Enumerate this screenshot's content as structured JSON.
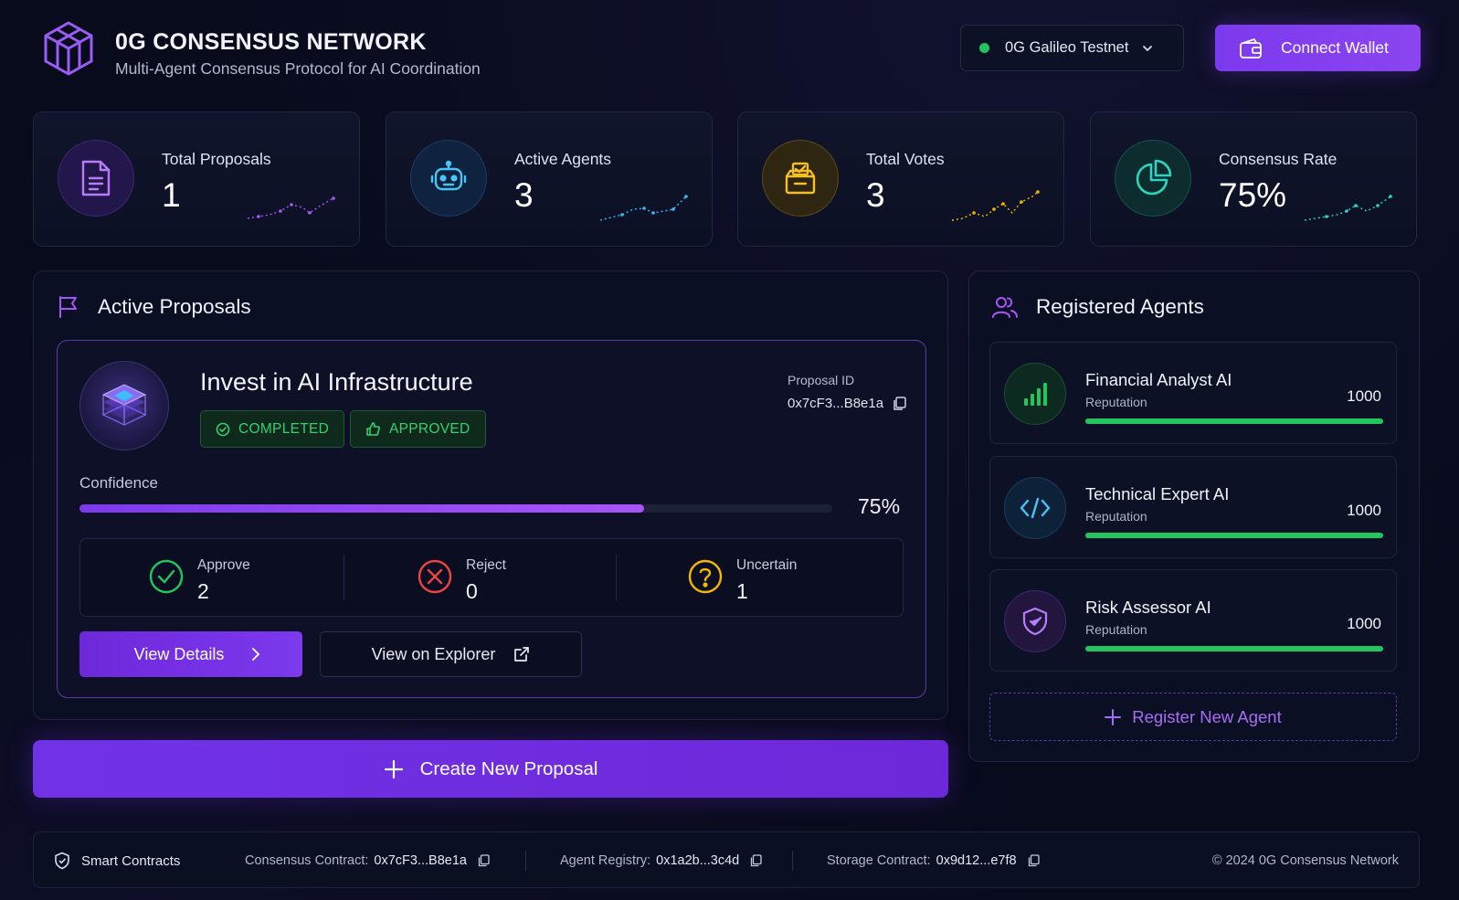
{
  "header": {
    "title": "0G CONSENSUS NETWORK",
    "subtitle": "Multi-Agent Consensus Protocol for AI Coordination",
    "network": "0G Galileo Testnet",
    "connect_label": "Connect Wallet"
  },
  "stats": [
    {
      "label": "Total Proposals",
      "value": "1",
      "color": "#a855f7",
      "icon": "document-icon"
    },
    {
      "label": "Active Agents",
      "value": "3",
      "color": "#38bdf8",
      "icon": "robot-icon"
    },
    {
      "label": "Total Votes",
      "value": "3",
      "color": "#f5b800",
      "icon": "ballot-box-icon"
    },
    {
      "label": "Consensus Rate",
      "value": "75%",
      "color": "#2dd4bf",
      "icon": "pie-chart-icon"
    }
  ],
  "proposals": {
    "title": "Active Proposals",
    "item": {
      "title": "Invest in AI Infrastructure",
      "status_badge": "COMPLETED",
      "result_badge": "APPROVED",
      "id_label": "Proposal ID",
      "id_value": "0x7cF3...B8e1a",
      "confidence_label": "Confidence",
      "confidence_value": "75%",
      "confidence_fraction": 0.75,
      "votes": [
        {
          "label": "Approve",
          "count": "2",
          "color": "#22c55e"
        },
        {
          "label": "Reject",
          "count": "0",
          "color": "#ef4444"
        },
        {
          "label": "Uncertain",
          "count": "1",
          "color": "#f5b800"
        }
      ],
      "details_label": "View Details",
      "explorer_label": "View on Explorer"
    },
    "create_label": "Create New Proposal"
  },
  "agents": {
    "title": "Registered Agents",
    "items": [
      {
        "name": "Financial Analyst AI",
        "rep_label": "Reputation",
        "rep_value": "1000",
        "color": "#22c55e",
        "icon": "bar-chart-icon"
      },
      {
        "name": "Technical Expert AI",
        "rep_label": "Reputation",
        "rep_value": "1000",
        "color": "#38bdf8",
        "icon": "code-icon"
      },
      {
        "name": "Risk Assessor AI",
        "rep_label": "Reputation",
        "rep_value": "1000",
        "color": "#a855f7",
        "icon": "shield-check-icon"
      }
    ],
    "register_label": "Register New Agent"
  },
  "footer": {
    "smart_contracts": "Smart Contracts",
    "consensus_label": "Consensus Contract:",
    "consensus_value": "0x7cF3...B8e1a",
    "registry_label": "Agent Registry:",
    "registry_value": "0x1a2b...3c4d",
    "storage_label": "Storage Contract:",
    "storage_value": "0x9d12...e7f8",
    "copyright": "© 2024 0G Consensus Network"
  }
}
